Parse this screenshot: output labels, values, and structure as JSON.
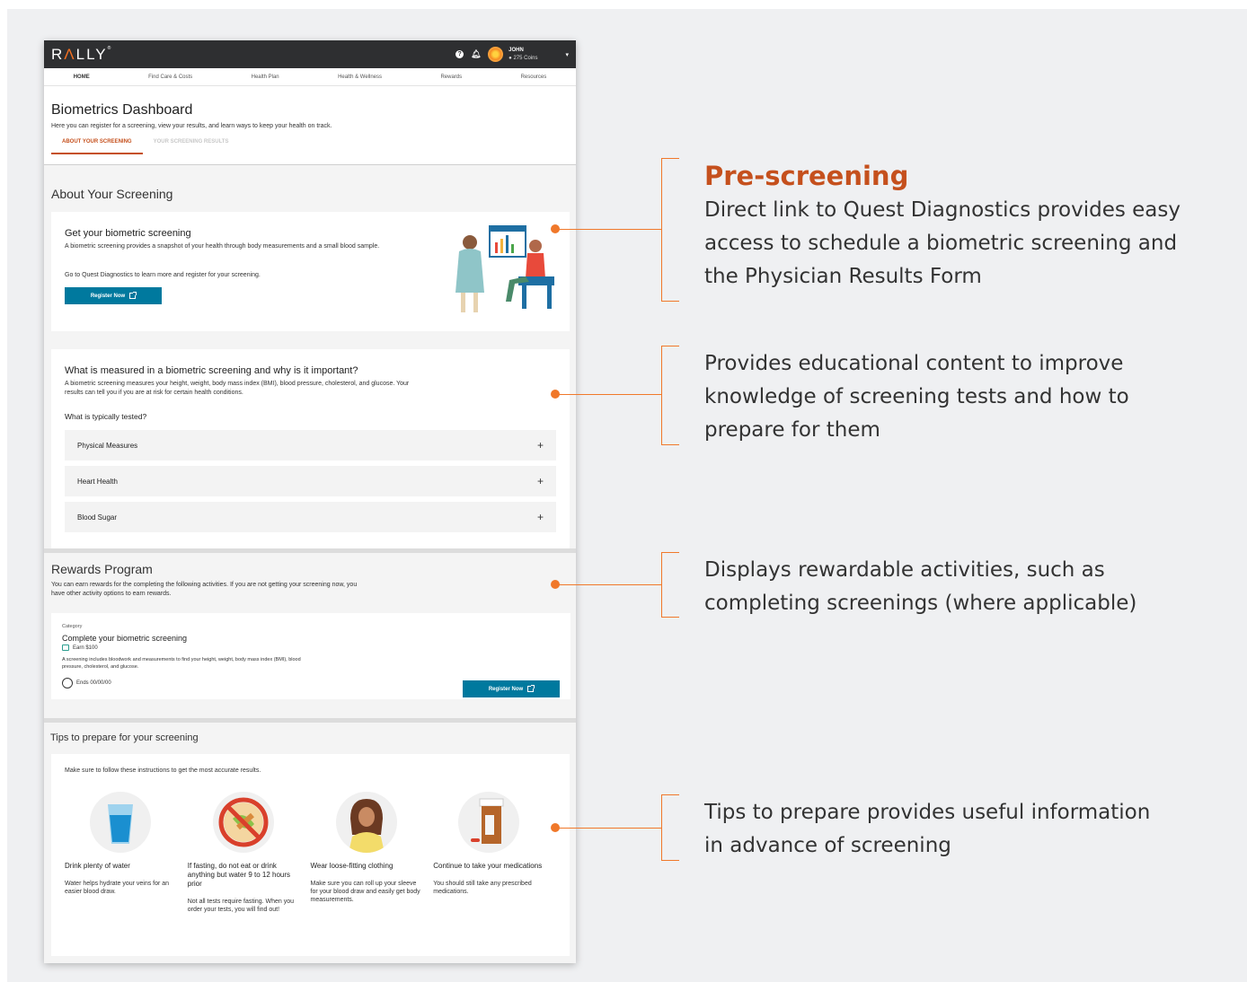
{
  "app": {
    "logo": "RALLY",
    "user_name": "JOHN",
    "user_coins": "275 Coins",
    "nav": [
      "HOME",
      "Find Care & Costs",
      "Health Plan",
      "Health & Wellness",
      "Rewards",
      "Resources"
    ],
    "page_title": "Biometrics Dashboard",
    "page_subtitle": "Here you can register for a screening, view your results, and learn ways to keep your health on track.",
    "tabs": [
      "ABOUT YOUR SCREENING",
      "YOUR SCREENING RESULTS"
    ]
  },
  "about": {
    "title": "About Your Screening",
    "card1_title": "Get your biometric screening",
    "card1_body": "A biometric screening provides a snapshot of your health through body measurements and a small blood sample.",
    "card1_body2": "Go to Quest Diagnostics to learn more and register for your screening.",
    "register_label": "Register Now",
    "card2_title": "What is measured in a biometric screening and why is it important?",
    "card2_body": "A biometric screening measures your height, weight, body mass index (BMI), blood pressure, cholesterol, and glucose. Your results can tell you if you are at risk for certain health conditions.",
    "card2_q": "What is typically tested?",
    "accordions": [
      "Physical Measures",
      "Heart Health",
      "Blood Sugar"
    ]
  },
  "rewards": {
    "title": "Rewards Program",
    "subtitle": "You can earn rewards for the completing the following activities. If you are not getting your screening now, you have other activity options to earn rewards.",
    "category": "Category",
    "activity": "Complete your biometric screening",
    "earn": "Earn $100",
    "desc": "A screening includes bloodwork and measurements to find your height, weight, body mass index (BMI), blood pressure, cholesterol, and glucose.",
    "ends": "Ends 00/00/00",
    "register_label": "Register Now"
  },
  "tips": {
    "title": "Tips to prepare for your screening",
    "intro": "Make sure to follow these instructions to get the most accurate results.",
    "items": [
      {
        "title": "Drink plenty of water",
        "body": "Water helps hydrate your veins for an easier blood draw.",
        "body2": ""
      },
      {
        "title": "If fasting, do not eat or drink anything but water 9 to 12 hours prior",
        "body": "Not all tests require fasting. When you order your tests, you will find out!",
        "body2": ""
      },
      {
        "title": "Wear loose-fitting clothing",
        "body": "Make sure you can roll up your sleeve for your blood draw and easily get body measurements.",
        "body2": ""
      },
      {
        "title": "Continue to take your medications",
        "body": "You should still take any prescribed medications.",
        "body2": ""
      }
    ]
  },
  "annotations": {
    "a1_title": "Pre-screening",
    "a1_text": "Direct link to Quest Diagnostics provides easy access to schedule a biometric screening and the Physician Results Form",
    "a2_text": "Provides educational content to improve knowledge of screening tests and how to prepare for them",
    "a3_text": "Displays rewardable activities, such as completing screenings (where applicable)",
    "a4_text": "Tips to prepare provides useful information in advance of screening"
  },
  "colors": {
    "accent": "#f0782a",
    "brand_orange": "#c5501d",
    "button_blue": "#00799e",
    "topbar": "#2e2f31"
  }
}
